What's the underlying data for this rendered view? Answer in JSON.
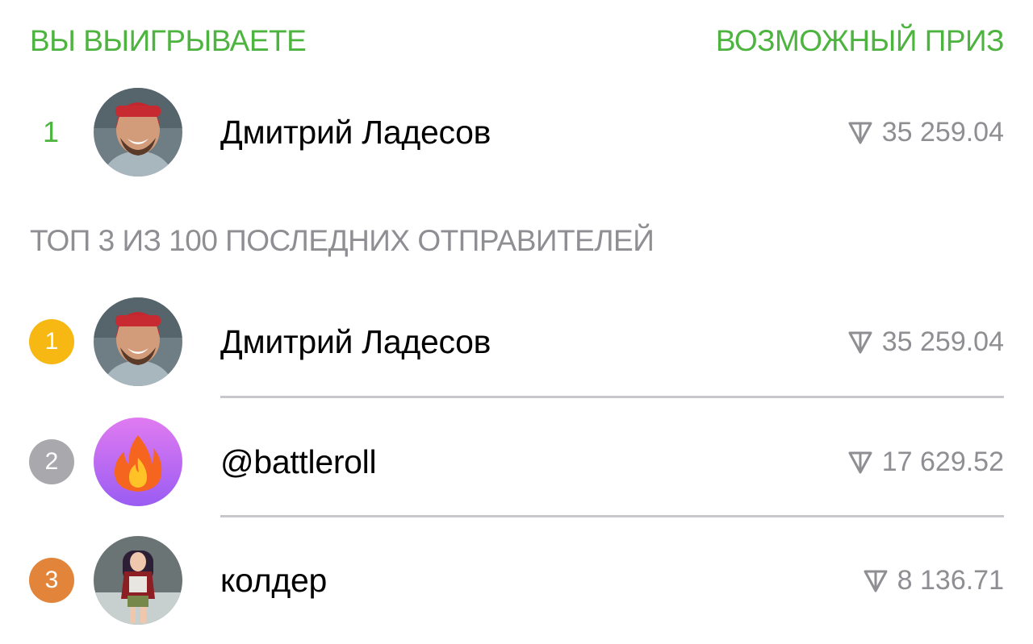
{
  "header": {
    "left_label": "ВЫ ВЫИГРЫВАЕТЕ",
    "right_label": "ВОЗМОЖНЫЙ ПРИЗ"
  },
  "winner": {
    "rank": "1",
    "name": "Дмитрий Ладесов",
    "amount": "35 259.04",
    "currency_icon": "ton-icon"
  },
  "top_section": {
    "label": "ТОП 3 ИЗ 100 ПОСЛЕДНИХ ОТПРАВИТЕЛЕЙ",
    "items": [
      {
        "rank": "1",
        "name": "Дмитрий Ладесов",
        "amount": "35 259.04",
        "badge_color": "#f8b814"
      },
      {
        "rank": "2",
        "name": "@battleroll",
        "amount": "17 629.52",
        "badge_color": "#a8a8ad"
      },
      {
        "rank": "3",
        "name": "колдер",
        "amount": "8 136.71",
        "badge_color": "#e2853a"
      }
    ]
  },
  "colors": {
    "accent": "#4cb43f",
    "secondary_text": "#8e8e93",
    "divider": "#c8c8cc"
  }
}
